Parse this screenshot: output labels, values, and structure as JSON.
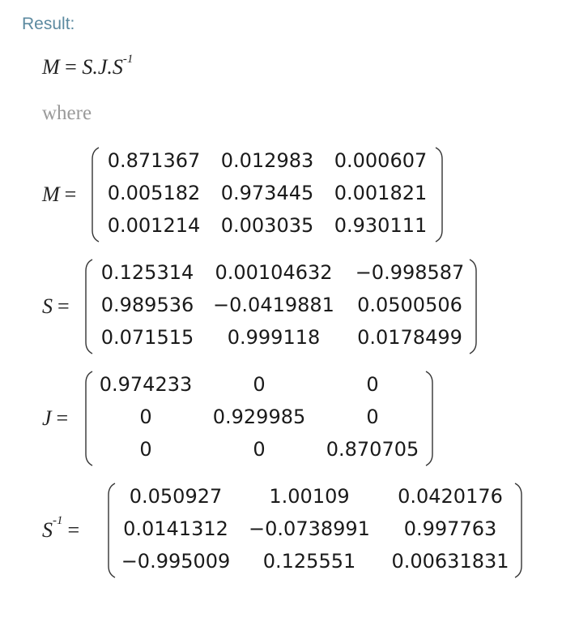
{
  "result_label": "Result:",
  "decomposition": {
    "lhs": "M",
    "equals": "=",
    "rhs_main": "S.J.S",
    "rhs_sup": "-1"
  },
  "where_label": "where",
  "matrices": [
    {
      "name": "M",
      "sup": "",
      "rows": [
        [
          "0.871367",
          "0.012983",
          "0.000607"
        ],
        [
          "0.005182",
          "0.973445",
          "0.001821"
        ],
        [
          "0.001214",
          "0.003035",
          "0.930111"
        ]
      ]
    },
    {
      "name": "S",
      "sup": "",
      "rows": [
        [
          "0.125314",
          "0.00104632",
          "−0.998587"
        ],
        [
          "0.989536",
          "−0.0419881",
          "0.0500506"
        ],
        [
          "0.071515",
          "0.999118",
          "0.0178499"
        ]
      ]
    },
    {
      "name": "J",
      "sup": "",
      "rows": [
        [
          "0.974233",
          "0",
          "0"
        ],
        [
          "0",
          "0.929985",
          "0"
        ],
        [
          "0",
          "0",
          "0.870705"
        ]
      ]
    },
    {
      "name": "S",
      "sup": "-1",
      "rows": [
        [
          "0.050927",
          "1.00109",
          "0.0420176"
        ],
        [
          "0.0141312",
          "−0.0738991",
          "0.997763"
        ],
        [
          "−0.995009",
          "0.125551",
          "0.00631831"
        ]
      ]
    }
  ]
}
